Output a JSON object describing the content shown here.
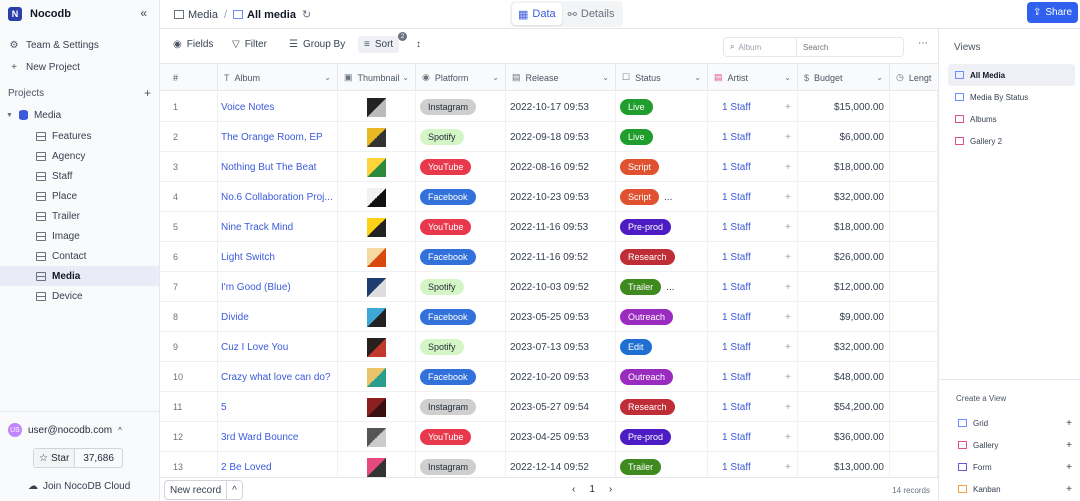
{
  "app": {
    "name": "Nocodb",
    "logo_letter": "N"
  },
  "sidebar": {
    "team_settings": "Team & Settings",
    "new_project": "New Project",
    "projects_label": "Projects",
    "project": "Media",
    "tables": [
      "Features",
      "Agency",
      "Staff",
      "Place",
      "Trailer",
      "Image",
      "Contact",
      "Media",
      "Device"
    ],
    "active_table": "Media",
    "user": {
      "initials": "US",
      "email": "user@nocodb.com"
    },
    "star_label": "Star",
    "star_count": "37,686",
    "cloud_label": "Join NocoDB Cloud"
  },
  "topbar": {
    "breadcrumb_table": "Media",
    "breadcrumb_sep": "/",
    "breadcrumb_view": "All media",
    "tab_data": "Data",
    "tab_details": "Details",
    "share_label": "Share"
  },
  "toolbar": {
    "fields": "Fields",
    "filter": "Filter",
    "group_by": "Group By",
    "sort": "Sort",
    "sort_count": "2",
    "search_field": "Album",
    "search_placeholder": "Search"
  },
  "columns": {
    "num": "#",
    "album": "Album",
    "thumbnail": "Thumbnail",
    "platform": "Platform",
    "release": "Release",
    "status": "Status",
    "artist": "Artist",
    "budget": "Budget",
    "length": "Lengt"
  },
  "colors": {
    "accent": "#3b5bdb",
    "share": "#3060ed",
    "platform": {
      "Instagram": {
        "bg": "#cfcfcf",
        "fg": "#1f2937"
      },
      "Spotify": {
        "bg": "#d4f5c5",
        "fg": "#1f2937"
      },
      "YouTube": {
        "bg": "#e8394c",
        "fg": "#ffffff"
      },
      "Facebook": {
        "bg": "#3271d9",
        "fg": "#ffffff"
      }
    },
    "status": {
      "Live": "#1f9e2e",
      "Script": "#e0522f",
      "Pre-prod": "#4d1cc4",
      "Research": "#bf2d36",
      "Trailer": "#3f8a1f",
      "Outreach": "#9a2bbf",
      "Edit": "#1f6fd1"
    }
  },
  "rows": [
    {
      "num": "1",
      "album": "Voice Notes",
      "thumb": [
        "#222",
        "#bbb"
      ],
      "platform": "Instagram",
      "release": "2022-10-17 09:53",
      "status": "Live",
      "more": "",
      "artist": "1 Staff",
      "budget": "$15,000.00"
    },
    {
      "num": "2",
      "album": "The Orange Room, EP",
      "thumb": [
        "#e8b923",
        "#333"
      ],
      "platform": "Spotify",
      "release": "2022-09-18 09:53",
      "status": "Live",
      "more": "",
      "artist": "1 Staff",
      "budget": "$6,000.00"
    },
    {
      "num": "3",
      "album": "Nothing But The Beat",
      "thumb": [
        "#ffd43b",
        "#2b8a3e"
      ],
      "platform": "YouTube",
      "release": "2022-08-16 09:52",
      "status": "Script",
      "more": "",
      "artist": "1 Staff",
      "budget": "$18,000.00"
    },
    {
      "num": "4",
      "album": "No.6 Collaboration Proj...",
      "thumb": [
        "#f1f1f1",
        "#111"
      ],
      "platform": "Facebook",
      "release": "2022-10-23 09:53",
      "status": "Script",
      "more": "...",
      "artist": "1 Staff",
      "budget": "$32,000.00"
    },
    {
      "num": "5",
      "album": "Nine Track Mind",
      "thumb": [
        "#fcd116",
        "#222"
      ],
      "platform": "YouTube",
      "release": "2022-11-16 09:53",
      "status": "Pre-prod",
      "more": "",
      "artist": "1 Staff",
      "budget": "$18,000.00"
    },
    {
      "num": "6",
      "album": "Light Switch",
      "thumb": [
        "#f5d9a0",
        "#d9480f"
      ],
      "platform": "Facebook",
      "release": "2022-11-16 09:52",
      "status": "Research",
      "more": "",
      "artist": "1 Staff",
      "budget": "$26,000.00"
    },
    {
      "num": "7",
      "album": "I'm Good (Blue)",
      "thumb": [
        "#1c3d6e",
        "#ddd"
      ],
      "platform": "Spotify",
      "release": "2022-10-03 09:52",
      "status": "Trailer",
      "more": "...",
      "artist": "1 Staff",
      "budget": "$12,000.00"
    },
    {
      "num": "8",
      "album": "Divide",
      "thumb": [
        "#3fa7d6",
        "#222"
      ],
      "platform": "Facebook",
      "release": "2023-05-25 09:53",
      "status": "Outreach",
      "more": "",
      "artist": "1 Staff",
      "budget": "$9,000.00"
    },
    {
      "num": "9",
      "album": "Cuz I Love You",
      "thumb": [
        "#2a1f1f",
        "#c0392b"
      ],
      "platform": "Spotify",
      "release": "2023-07-13 09:53",
      "status": "Edit",
      "more": "",
      "artist": "1 Staff",
      "budget": "$32,000.00"
    },
    {
      "num": "10",
      "album": "Crazy what love can do?",
      "thumb": [
        "#e9c46a",
        "#2a9d8f"
      ],
      "platform": "Facebook",
      "release": "2022-10-20 09:53",
      "status": "Outreach",
      "more": "",
      "artist": "1 Staff",
      "budget": "$48,000.00"
    },
    {
      "num": "11",
      "album": "5",
      "thumb": [
        "#8b1e1e",
        "#3b1010"
      ],
      "platform": "Instagram",
      "release": "2023-05-27 09:54",
      "status": "Research",
      "more": "",
      "artist": "1 Staff",
      "budget": "$54,200.00"
    },
    {
      "num": "12",
      "album": "3rd Ward Bounce",
      "thumb": [
        "#555",
        "#ccc"
      ],
      "platform": "YouTube",
      "release": "2023-04-25 09:53",
      "status": "Pre-prod",
      "more": "",
      "artist": "1 Staff",
      "budget": "$36,000.00"
    },
    {
      "num": "13",
      "album": "2 Be Loved",
      "thumb": [
        "#e64980",
        "#333"
      ],
      "platform": "Instagram",
      "release": "2022-12-14 09:52",
      "status": "Trailer",
      "more": "",
      "artist": "1 Staff",
      "budget": "$13,000.00"
    }
  ],
  "footer": {
    "new_record": "New record",
    "page": "1",
    "records": "14 records"
  },
  "views": {
    "title": "Views",
    "items": [
      {
        "label": "All Media",
        "kind": "grid",
        "active": true
      },
      {
        "label": "Media By Status",
        "kind": "grid",
        "active": false
      },
      {
        "label": "Albums",
        "kind": "gallery",
        "active": false
      },
      {
        "label": "Gallery 2",
        "kind": "gallery",
        "active": false
      }
    ],
    "create_title": "Create a View",
    "create_items": [
      {
        "label": "Grid",
        "kind": "grid"
      },
      {
        "label": "Gallery",
        "kind": "gallery"
      },
      {
        "label": "Form",
        "kind": "form"
      },
      {
        "label": "Kanban",
        "kind": "kanban"
      }
    ]
  }
}
